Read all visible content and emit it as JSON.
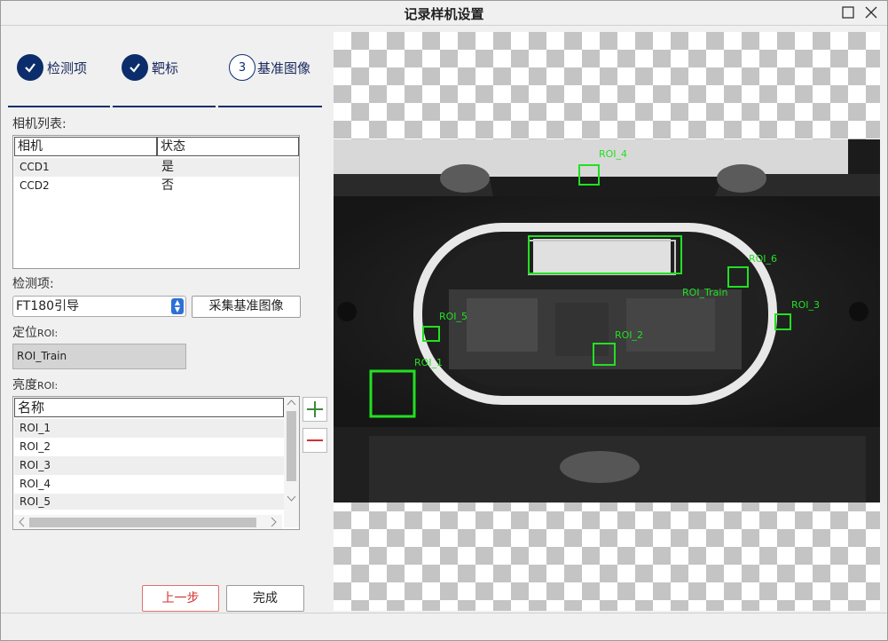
{
  "window": {
    "title": "记录样机设置"
  },
  "steps": [
    {
      "label": "检测项",
      "done": true
    },
    {
      "label": "靶标",
      "done": true
    },
    {
      "label": "基准图像",
      "number": "3",
      "done": false
    }
  ],
  "camera_list": {
    "label": "相机列表:",
    "columns": [
      "相机",
      "状态"
    ],
    "rows": [
      [
        "CCD1",
        "是"
      ],
      [
        "CCD2",
        "否"
      ]
    ]
  },
  "inspection": {
    "label": "检测项:",
    "selected": "FT180引导"
  },
  "capture_button": "采集基准图像",
  "locate_roi": {
    "label_main": "定位",
    "label_suffix": "ROI:",
    "value": "ROI_Train"
  },
  "brightness_roi": {
    "label_main": "亮度",
    "label_suffix": "ROI:",
    "header": "名称",
    "rows": [
      "ROI_1",
      "ROI_2",
      "ROI_3",
      "ROI_4",
      "ROI_5"
    ]
  },
  "buttons": {
    "prev": "上一步",
    "finish": "完成"
  },
  "image_rois": [
    {
      "label": "ROI_4"
    },
    {
      "label": "ROI_6"
    },
    {
      "label": "ROI_Train"
    },
    {
      "label": "ROI_3"
    },
    {
      "label": "ROI_5"
    },
    {
      "label": "ROI_2"
    },
    {
      "label": "ROI_1"
    }
  ],
  "colors": {
    "accent": "#0c2d6b",
    "roi": "#22e022",
    "prev_text": "#d0312d"
  }
}
